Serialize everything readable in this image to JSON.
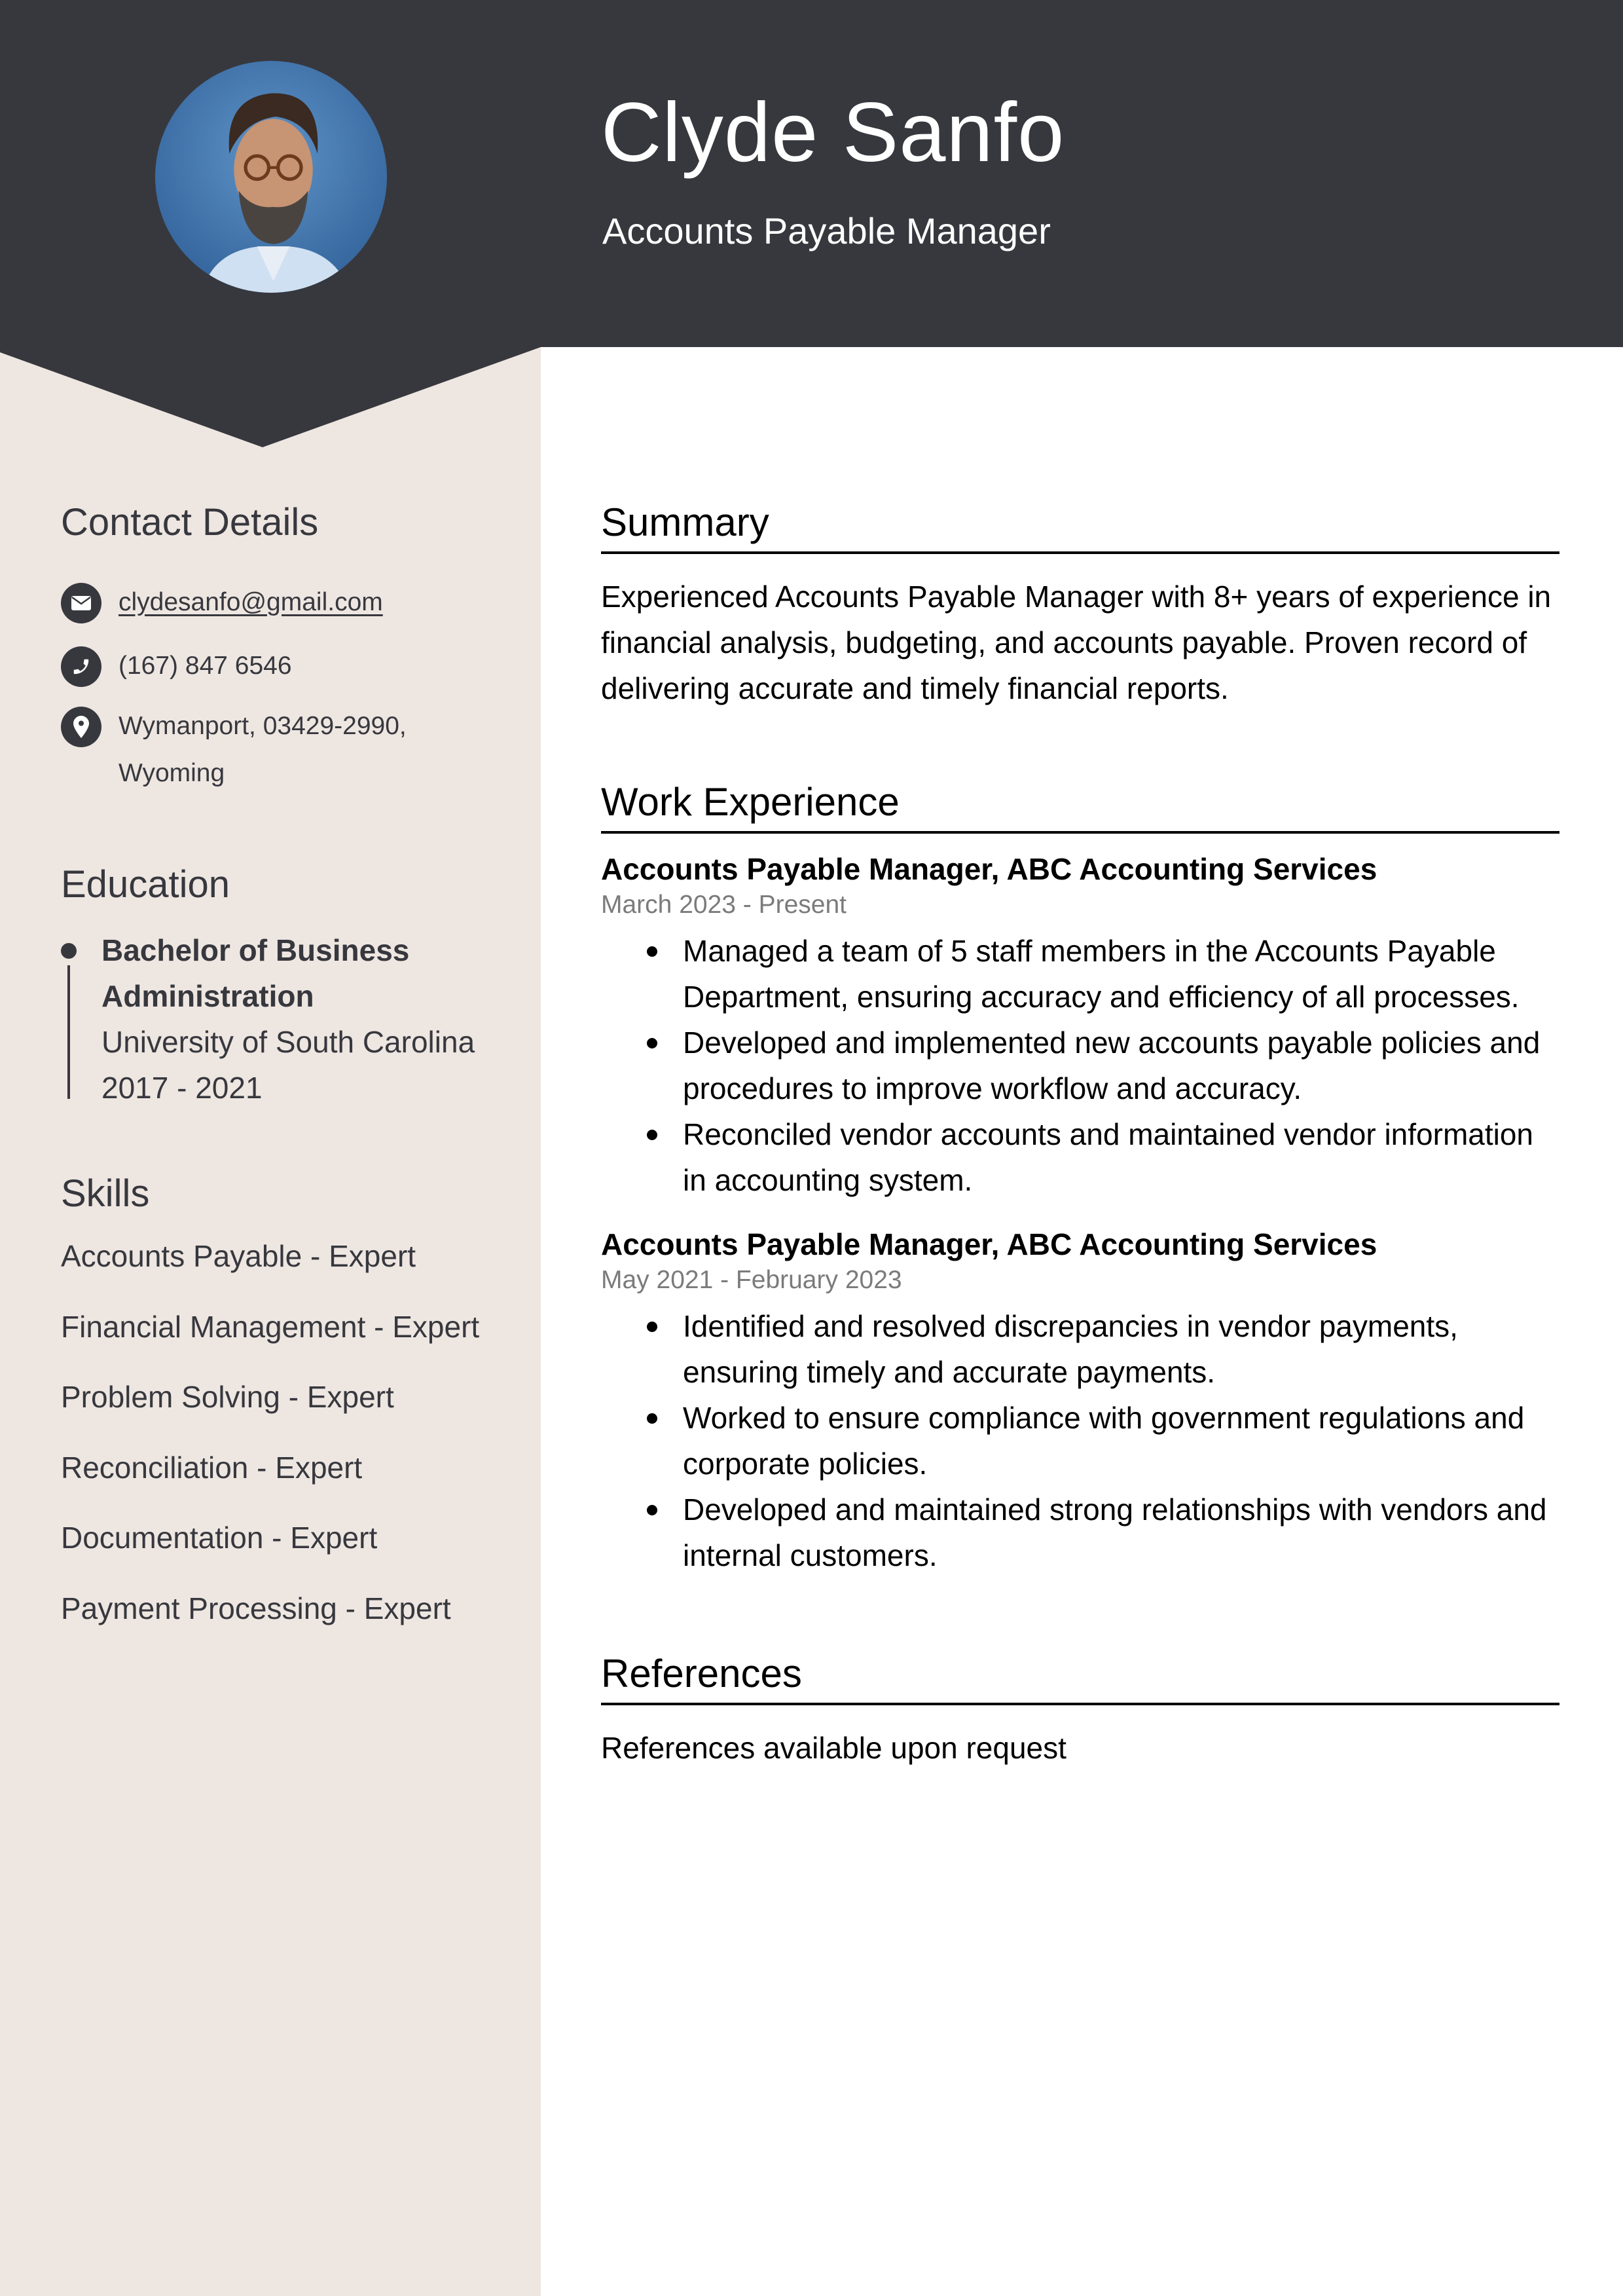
{
  "header": {
    "name": "Clyde Sanfo",
    "title": "Accounts Payable Manager",
    "photo_alt": "profile-photo"
  },
  "colors": {
    "header_bg": "#37383e",
    "sidebar_bg": "#eee6e1",
    "text_dark": "#37383e",
    "date_gray": "#7b7b7b"
  },
  "sidebar": {
    "contact": {
      "heading": "Contact Details",
      "email": "clydesanfo@gmail.com",
      "phone": "(167) 847 6546",
      "address_line1": "Wymanport, 03429-2990,",
      "address_line2": "Wyoming",
      "icons": [
        "envelope-icon",
        "phone-icon",
        "location-pin-icon"
      ]
    },
    "education": {
      "heading": "Education",
      "entries": [
        {
          "degree_line1": "Bachelor of Business",
          "degree_line2": "Administration",
          "school": "University of South Carolina",
          "years": "2017 - 2021"
        }
      ]
    },
    "skills": {
      "heading": "Skills",
      "items": [
        "Accounts Payable - Expert",
        "Financial Management - Expert",
        "Problem Solving - Expert",
        "Reconciliation - Expert",
        "Documentation - Expert",
        "Payment Processing - Expert"
      ]
    }
  },
  "main": {
    "summary": {
      "heading": "Summary",
      "lines": [
        "Experienced Accounts Payable Manager with 8+ years of experience in",
        "financial analysis, budgeting, and accounts payable. Proven record of",
        "delivering accurate and timely financial reports."
      ]
    },
    "work": {
      "heading": "Work Experience",
      "jobs": [
        {
          "title": "Accounts Payable Manager, ABC Accounting Services",
          "dates": "March 2023 - Present",
          "bullets": [
            [
              "Managed a team of 5 staff members in the Accounts Payable",
              "Department, ensuring accuracy and efficiency of all processes."
            ],
            [
              "Developed and implemented new accounts payable policies and",
              "procedures to improve workflow and accuracy."
            ],
            [
              "Reconciled vendor accounts and maintained vendor information",
              "in accounting system."
            ]
          ]
        },
        {
          "title": "Accounts Payable Manager, ABC Accounting Services",
          "dates": "May 2021 - February 2023",
          "bullets": [
            [
              "Identified and resolved discrepancies in vendor payments,",
              "ensuring timely and accurate payments."
            ],
            [
              "Worked to ensure compliance with government regulations and",
              "corporate policies."
            ],
            [
              "Developed and maintained strong relationships with vendors and",
              "internal customers."
            ]
          ]
        }
      ]
    },
    "references": {
      "heading": "References",
      "text": "References available upon request"
    }
  }
}
